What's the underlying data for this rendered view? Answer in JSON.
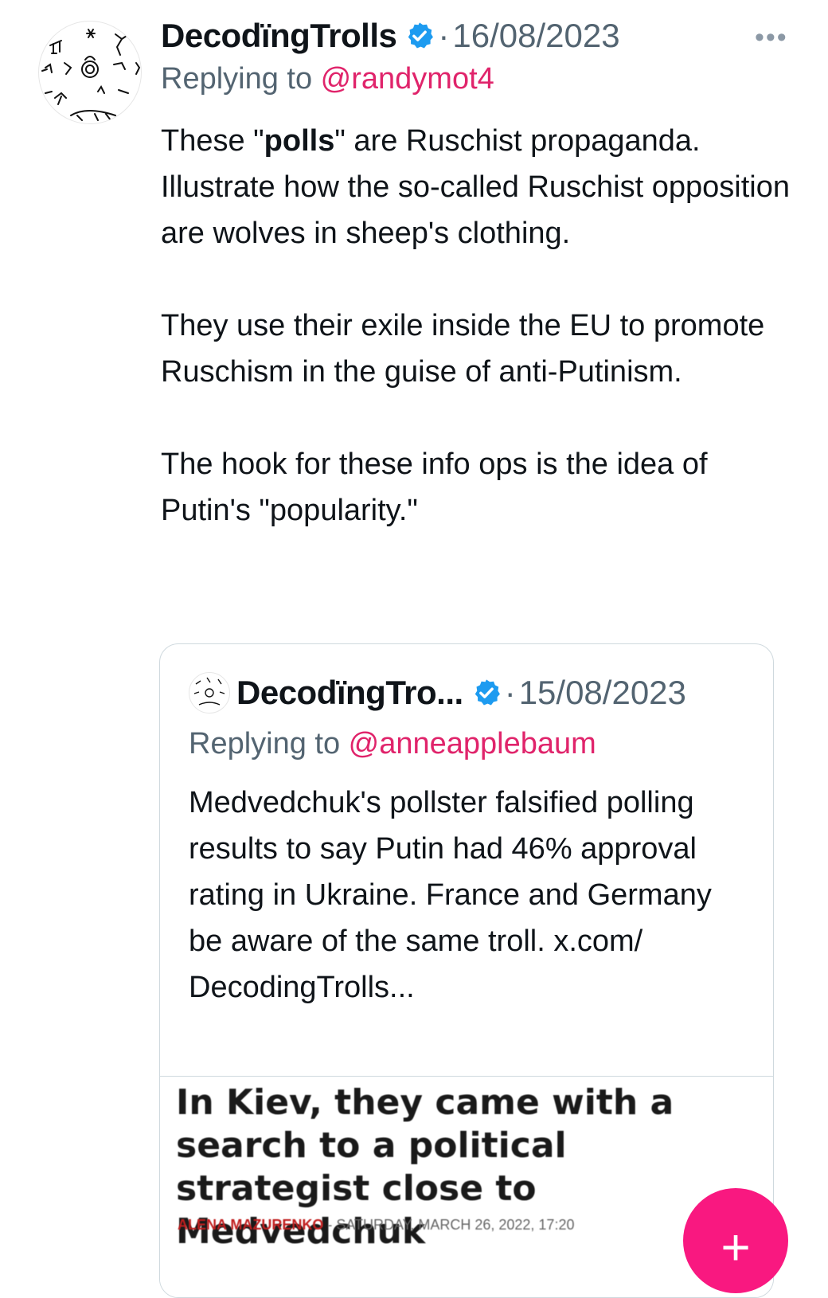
{
  "tweet": {
    "author": "DecodïngTrolls",
    "separator": "·",
    "date": "16/08/2023",
    "more_label": "•••",
    "replying_prefix": "Replying to ",
    "replying_handle": "@randymot4",
    "paragraphs": [
      {
        "before": "These \"",
        "bold": "polls",
        "after": "\" are Ruschist propaganda. Illustrate how the so-called Ruschist opposition are wolves in sheep's clothing."
      },
      {
        "text": "They use their exile inside the EU to promote Ruschism in the guise of anti-Putinism."
      },
      {
        "text": "The hook for these info ops is the idea of Putin's \"popularity.\""
      }
    ]
  },
  "quote": {
    "author": "DecodïngTro...",
    "separator": "·",
    "date": "15/08/2023",
    "replying_prefix": "Replying to ",
    "replying_handle": "@anneapplebaum",
    "text": "Medvedchuk's pollster falsified polling results to say Putin had 46% approval rating in Ukraine. France and Germany be aware of the same troll. x.com/ DecodingTrolls...",
    "card": {
      "headline": "In Kiev, they came with a search to a political strategist close to Medvedchuk",
      "byline_author": "ALENA MAZURENKO",
      "byline_rest": " - SATURDAY, MARCH 26, 2022, 17:20"
    }
  },
  "fab": {
    "label": "+"
  },
  "colors": {
    "mention": "#e0246b",
    "verified": "#1d9bf0",
    "fab": "#f91880",
    "secondary_text": "#536471"
  },
  "icons": {
    "verified": "verified-badge-icon",
    "avatar": "petroglyph-avatar",
    "more": "more-dots-icon",
    "compose": "plus-icon"
  }
}
